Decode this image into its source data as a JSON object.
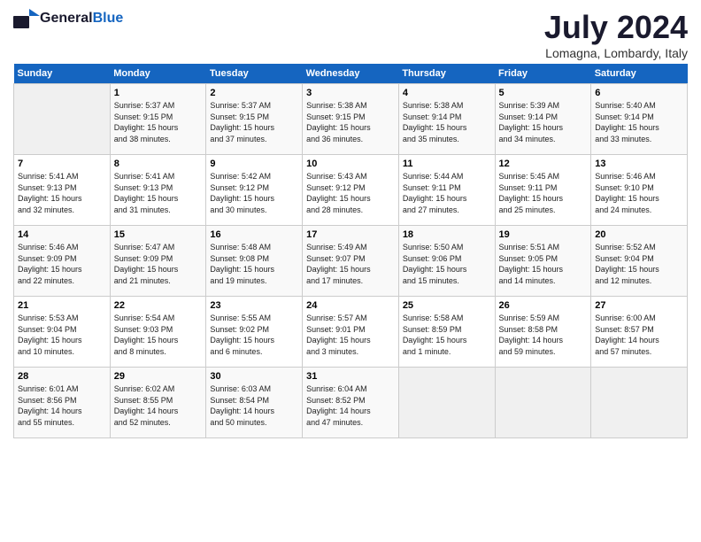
{
  "header": {
    "logo_general": "General",
    "logo_blue": "Blue",
    "title": "July 2024",
    "location": "Lomagna, Lombardy, Italy"
  },
  "calendar": {
    "weekdays": [
      "Sunday",
      "Monday",
      "Tuesday",
      "Wednesday",
      "Thursday",
      "Friday",
      "Saturday"
    ],
    "weeks": [
      [
        {
          "day": "",
          "info": ""
        },
        {
          "day": "1",
          "info": "Sunrise: 5:37 AM\nSunset: 9:15 PM\nDaylight: 15 hours\nand 38 minutes."
        },
        {
          "day": "2",
          "info": "Sunrise: 5:37 AM\nSunset: 9:15 PM\nDaylight: 15 hours\nand 37 minutes."
        },
        {
          "day": "3",
          "info": "Sunrise: 5:38 AM\nSunset: 9:15 PM\nDaylight: 15 hours\nand 36 minutes."
        },
        {
          "day": "4",
          "info": "Sunrise: 5:38 AM\nSunset: 9:14 PM\nDaylight: 15 hours\nand 35 minutes."
        },
        {
          "day": "5",
          "info": "Sunrise: 5:39 AM\nSunset: 9:14 PM\nDaylight: 15 hours\nand 34 minutes."
        },
        {
          "day": "6",
          "info": "Sunrise: 5:40 AM\nSunset: 9:14 PM\nDaylight: 15 hours\nand 33 minutes."
        }
      ],
      [
        {
          "day": "7",
          "info": "Sunrise: 5:41 AM\nSunset: 9:13 PM\nDaylight: 15 hours\nand 32 minutes."
        },
        {
          "day": "8",
          "info": "Sunrise: 5:41 AM\nSunset: 9:13 PM\nDaylight: 15 hours\nand 31 minutes."
        },
        {
          "day": "9",
          "info": "Sunrise: 5:42 AM\nSunset: 9:12 PM\nDaylight: 15 hours\nand 30 minutes."
        },
        {
          "day": "10",
          "info": "Sunrise: 5:43 AM\nSunset: 9:12 PM\nDaylight: 15 hours\nand 28 minutes."
        },
        {
          "day": "11",
          "info": "Sunrise: 5:44 AM\nSunset: 9:11 PM\nDaylight: 15 hours\nand 27 minutes."
        },
        {
          "day": "12",
          "info": "Sunrise: 5:45 AM\nSunset: 9:11 PM\nDaylight: 15 hours\nand 25 minutes."
        },
        {
          "day": "13",
          "info": "Sunrise: 5:46 AM\nSunset: 9:10 PM\nDaylight: 15 hours\nand 24 minutes."
        }
      ],
      [
        {
          "day": "14",
          "info": "Sunrise: 5:46 AM\nSunset: 9:09 PM\nDaylight: 15 hours\nand 22 minutes."
        },
        {
          "day": "15",
          "info": "Sunrise: 5:47 AM\nSunset: 9:09 PM\nDaylight: 15 hours\nand 21 minutes."
        },
        {
          "day": "16",
          "info": "Sunrise: 5:48 AM\nSunset: 9:08 PM\nDaylight: 15 hours\nand 19 minutes."
        },
        {
          "day": "17",
          "info": "Sunrise: 5:49 AM\nSunset: 9:07 PM\nDaylight: 15 hours\nand 17 minutes."
        },
        {
          "day": "18",
          "info": "Sunrise: 5:50 AM\nSunset: 9:06 PM\nDaylight: 15 hours\nand 15 minutes."
        },
        {
          "day": "19",
          "info": "Sunrise: 5:51 AM\nSunset: 9:05 PM\nDaylight: 15 hours\nand 14 minutes."
        },
        {
          "day": "20",
          "info": "Sunrise: 5:52 AM\nSunset: 9:04 PM\nDaylight: 15 hours\nand 12 minutes."
        }
      ],
      [
        {
          "day": "21",
          "info": "Sunrise: 5:53 AM\nSunset: 9:04 PM\nDaylight: 15 hours\nand 10 minutes."
        },
        {
          "day": "22",
          "info": "Sunrise: 5:54 AM\nSunset: 9:03 PM\nDaylight: 15 hours\nand 8 minutes."
        },
        {
          "day": "23",
          "info": "Sunrise: 5:55 AM\nSunset: 9:02 PM\nDaylight: 15 hours\nand 6 minutes."
        },
        {
          "day": "24",
          "info": "Sunrise: 5:57 AM\nSunset: 9:01 PM\nDaylight: 15 hours\nand 3 minutes."
        },
        {
          "day": "25",
          "info": "Sunrise: 5:58 AM\nSunset: 8:59 PM\nDaylight: 15 hours\nand 1 minute."
        },
        {
          "day": "26",
          "info": "Sunrise: 5:59 AM\nSunset: 8:58 PM\nDaylight: 14 hours\nand 59 minutes."
        },
        {
          "day": "27",
          "info": "Sunrise: 6:00 AM\nSunset: 8:57 PM\nDaylight: 14 hours\nand 57 minutes."
        }
      ],
      [
        {
          "day": "28",
          "info": "Sunrise: 6:01 AM\nSunset: 8:56 PM\nDaylight: 14 hours\nand 55 minutes."
        },
        {
          "day": "29",
          "info": "Sunrise: 6:02 AM\nSunset: 8:55 PM\nDaylight: 14 hours\nand 52 minutes."
        },
        {
          "day": "30",
          "info": "Sunrise: 6:03 AM\nSunset: 8:54 PM\nDaylight: 14 hours\nand 50 minutes."
        },
        {
          "day": "31",
          "info": "Sunrise: 6:04 AM\nSunset: 8:52 PM\nDaylight: 14 hours\nand 47 minutes."
        },
        {
          "day": "",
          "info": ""
        },
        {
          "day": "",
          "info": ""
        },
        {
          "day": "",
          "info": ""
        }
      ]
    ]
  }
}
